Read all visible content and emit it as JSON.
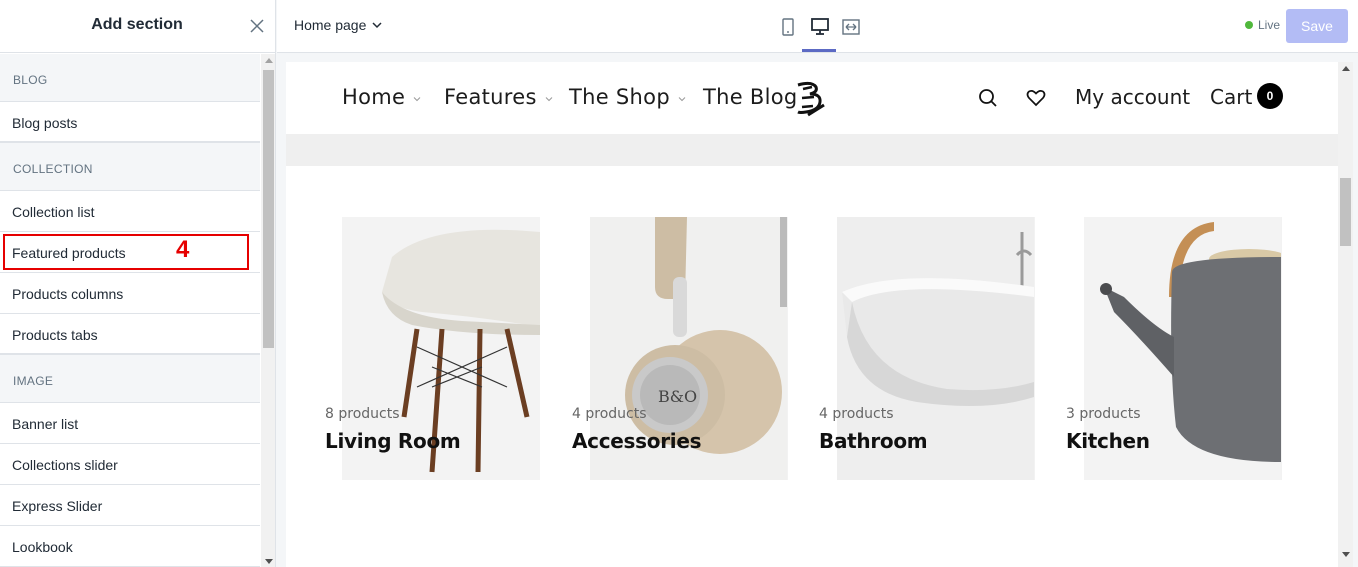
{
  "sidebar": {
    "title": "Add section",
    "annotation": "4",
    "groups": [
      {
        "label": "BLOG",
        "items": [
          "Blog posts"
        ]
      },
      {
        "label": "COLLECTION",
        "items": [
          "Collection list",
          "Featured products",
          "Products columns",
          "Products tabs"
        ]
      },
      {
        "label": "IMAGE",
        "items": [
          "Banner list",
          "Collections slider",
          "Express Slider",
          "Lookbook"
        ]
      }
    ]
  },
  "topbar": {
    "page_select": "Home page",
    "status": "Live",
    "save_label": "Save"
  },
  "store": {
    "nav": [
      "Home",
      "Features",
      "The Shop",
      "The Blog"
    ],
    "account": "My account",
    "cart": "Cart",
    "cart_count": "0",
    "collections": [
      {
        "count": "8 products",
        "title": "Living Room"
      },
      {
        "count": "4 products",
        "title": "Accessories"
      },
      {
        "count": "4 products",
        "title": "Bathroom"
      },
      {
        "count": "3 products",
        "title": "Kitchen"
      }
    ]
  },
  "colors": {
    "accent": "#5c6ac4",
    "save_disabled": "#b3bcf5",
    "live": "#50b83c",
    "annotation": "#e60000"
  }
}
